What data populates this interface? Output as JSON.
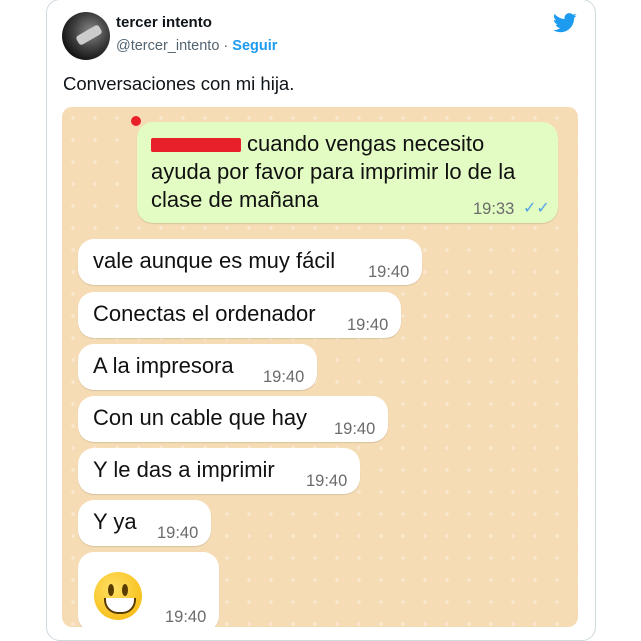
{
  "tweet": {
    "display_name": "tercer intento",
    "handle": "@tercer_intento",
    "separator": " · ",
    "follow_label": "Seguir",
    "text": "Conversaciones con mi hija."
  },
  "chat": {
    "outgoing": {
      "text_after_redaction": "cuando vengas necesito ayuda por favor para imprimir lo de la clase de mañana",
      "line1": "cuando vengas necesito",
      "line2": "ayuda por favor para imprimir lo de la",
      "line3": "clase de mañana",
      "time": "19:33",
      "ticks": "✓✓"
    },
    "incoming": [
      {
        "text": "vale aunque es muy fácil",
        "time": "19:40"
      },
      {
        "text": "Conectas el ordenador",
        "time": "19:40"
      },
      {
        "text": "A la impresora",
        "time": "19:40"
      },
      {
        "text": "Con un cable que hay",
        "time": "19:40"
      },
      {
        "text": "Y le das a imprimir",
        "time": "19:40"
      },
      {
        "text": "Y ya",
        "time": "19:40"
      },
      {
        "text": "",
        "time": "19:40",
        "emoji": "grinning-face-icon"
      }
    ]
  },
  "colors": {
    "chat_background": "#f6dcb5",
    "outgoing_bubble": "#e2fcc4",
    "incoming_bubble": "#ffffff",
    "twitter_blue": "#1d9bf0",
    "redaction": "#e8202a"
  }
}
